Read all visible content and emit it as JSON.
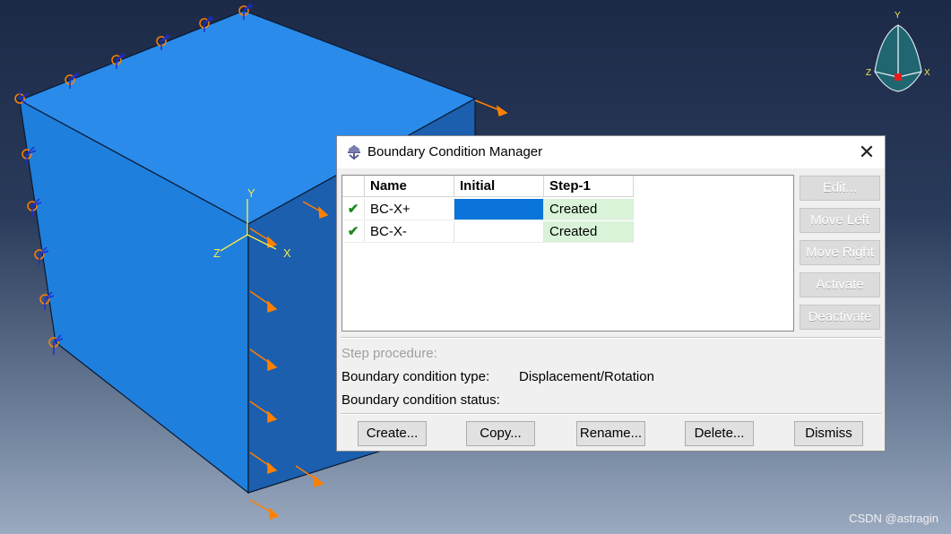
{
  "dialog": {
    "title": "Boundary Condition Manager",
    "close_glyph": "✕",
    "table": {
      "headers": [
        "Name",
        "Initial",
        "Step-1"
      ],
      "rows": [
        {
          "check": "✔",
          "name": "BC-X+",
          "initial": "",
          "step1": "Created"
        },
        {
          "check": "✔",
          "name": "BC-X-",
          "initial": "",
          "step1": "Created"
        }
      ]
    },
    "side_buttons": [
      "Edit...",
      "Move Left",
      "Move Right",
      "Activate",
      "Deactivate"
    ],
    "step_procedure_label": "Step procedure:",
    "bc_type_label": "Boundary condition type:",
    "bc_type_value": "Displacement/Rotation",
    "bc_status_label": "Boundary condition status:",
    "bottom_buttons": [
      "Create...",
      "Copy...",
      "Rename...",
      "Delete...",
      "Dismiss"
    ]
  },
  "viewport": {
    "axis_labels": {
      "y": "Y",
      "x": "X",
      "z": "Z"
    },
    "triad_labels": {
      "y": "Y",
      "x": "X",
      "z": "Z"
    },
    "block_color": "#1e7fdc",
    "bc_symbol_color": "#ff8000",
    "constraint_color": "#1a2fd0"
  },
  "watermark": "CSDN @astragin"
}
